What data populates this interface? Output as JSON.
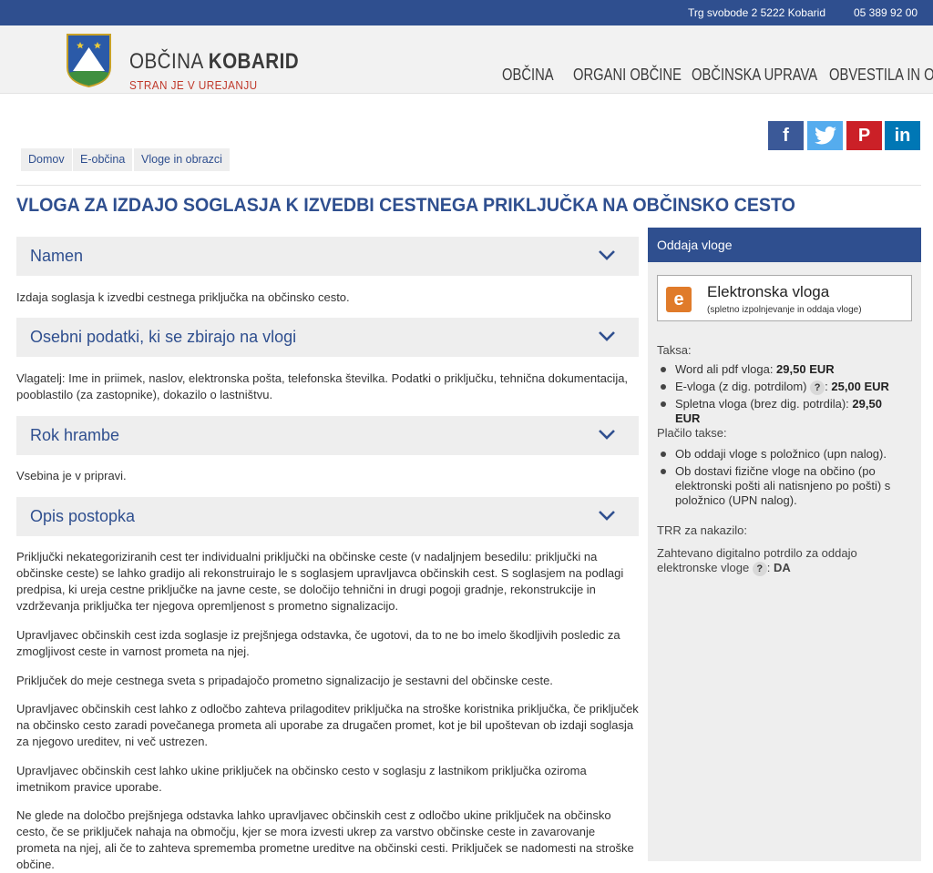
{
  "topbar": {
    "address": "Trg svobode 2 5222 Kobarid",
    "phone": "05 389 92 00"
  },
  "header": {
    "brand_prefix": "OBČINA ",
    "brand_name": "KOBARID",
    "slogan": "STRAN JE V UREJANJU",
    "nav": [
      "OBČINA",
      "ORGANI OBČINE",
      "OBČINSKA UPRAVA",
      "OBVESTILA IN OBJAVE"
    ]
  },
  "social": {
    "facebook": "f",
    "twitter": "twitter-icon",
    "pinterest": "P",
    "linkedin": "in"
  },
  "breadcrumb": [
    "Domov",
    "E-občina",
    "Vloge in obrazci"
  ],
  "page": {
    "title": "VLOGA ZA IZDAJO SOGLASJA K IZVEDBI CESTNEGA PRIKLJUČKA NA OBČINSKO CESTO"
  },
  "sections": {
    "namen": {
      "label": "Namen",
      "text": "Izdaja soglasja k izvedbi cestnega priključka na občinsko cesto."
    },
    "osebni": {
      "label": "Osebni podatki, ki se zbirajo na vlogi",
      "text": "Vlagatelj: Ime in priimek, naslov, elektronska pošta, telefonska številka. Podatki o priključku, tehnična dokumentacija, pooblastilo (za zastopnike), dokazilo o lastništvu."
    },
    "rok": {
      "label": "Rok hrambe",
      "text": "Vsebina je v pripravi."
    },
    "opis": {
      "label": "Opis postopka",
      "paragraphs": [
        "Priključki nekategoriziranih cest ter individualni priključki na občinske ceste (v nadaljnjem besedilu: priključki na občinske ceste) se lahko gradijo ali rekonstruirajo le s soglasjem upravljavca občinskih cest. S soglasjem na podlagi predpisa, ki ureja cestne priključke na javne ceste, se določijo tehnični in drugi pogoji gradnje, rekonstrukcije in vzdrževanja priključka ter njegova opremljenost s prometno signalizacijo.",
        "Upravljavec občinskih cest izda soglasje iz prejšnjega odstavka, če ugotovi, da to ne bo imelo škodljivih posledic za zmogljivost ceste in varnost prometa na njej.",
        "Priključek do meje cestnega sveta s pripadajočo prometno signalizacijo je sestavni del občinske ceste.",
        "Upravljavec občinskih cest lahko z odločbo zahteva prilagoditev priključka na stroške koristnika priključka, če priključek na občinsko cesto zaradi povečanega prometa ali uporabe za drugačen promet, kot je bil upoštevan ob izdaji soglasja za njegovo ureditev, ni več ustrezen.",
        "Upravljavec občinskih cest lahko ukine priključek na občinsko cesto v soglasju z lastnikom priključka oziroma imetnikom pravice uporabe.",
        "Ne glede na določbo prejšnjega odstavka lahko upravljavec občinskih cest z odločbo ukine priključek na občinsko cesto, če se priključek nahaja na območju, kjer se mora izvesti ukrep za varstvo občinske ceste in zavarovanje prometa na njej, ali če to zahteva sprememba prometne ureditve na občinski cesti. Priključek se nadomesti na stroške občine."
      ]
    }
  },
  "sidebar": {
    "heading": "Oddaja vloge",
    "evloga_title": "Elektronska vloga",
    "evloga_sub": "(spletno izpolnjevanje in oddaja vloge)",
    "evloga_icon": "e",
    "taksa_label": "Taksa:",
    "taksa": [
      {
        "name": "Word ali pdf vloga: ",
        "price": "29,50 EUR"
      },
      {
        "name": "E-vloga (z dig. potrdilom) ",
        "help": "?",
        "after": ": ",
        "price": "25,00 EUR"
      },
      {
        "name": "Spletna vloga (brez dig. potrdila): ",
        "price": "29,50 EUR"
      }
    ],
    "placilo_label": "Plačilo takse:",
    "placilo": [
      "Ob oddaji vloge s položnico (upn nalog).",
      "Ob dostavi fizične vloge na občino (po elektronski pošti ali natisnjeno po pošti) s položnico (UPN nalog)."
    ],
    "trr_label": "TRR za nakazilo:",
    "digital_text": "Zahtevano digitalno potrdilo za oddajo elektronske vloge",
    "digital_help": "?",
    "digital_sep": ": ",
    "digital_value": "DA"
  }
}
